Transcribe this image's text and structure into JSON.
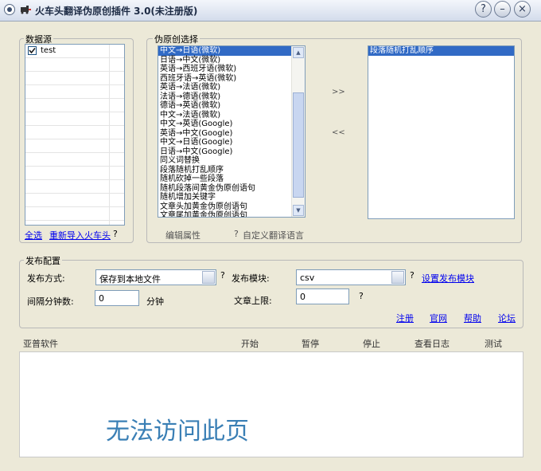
{
  "window": {
    "title": "火车头翻译伪原创插件 3.0(未注册版)",
    "buttons": {
      "help": "?",
      "minimize": "–",
      "close": "×"
    }
  },
  "datasource": {
    "label": "数据源",
    "items": [
      {
        "label": "test",
        "checked": true
      }
    ],
    "select_all": "全选",
    "reimport": "重新导入火车头",
    "help": "?"
  },
  "pseudo": {
    "label": "伪原创选择",
    "options": [
      "中文→日语(微软)",
      "日语→中文(微软)",
      "英语→西班牙语(微软)",
      "西班牙语→英语(微软)",
      "英语→法语(微软)",
      "法语→德语(微软)",
      "德语→英语(微软)",
      "中文→法语(微软)",
      "中文→英语(Google)",
      "英语→中文(Google)",
      "中文→日语(Google)",
      "日语→中文(Google)",
      "同义词替换",
      "段落随机打乱顺序",
      "随机砍掉一些段落",
      "随机段落间黄金伪原创语句",
      "随机增加关键字",
      "文章头加黄金伪原创语句",
      "文章尾加黄金伪原创语句"
    ],
    "selected_index": 0,
    "add_arrow": ">>",
    "remove_arrow": "<<",
    "chosen": [
      "段落随机打乱顺序"
    ],
    "edit_props": "编辑属性",
    "custom_lang_help": "?",
    "custom_lang": "自定义翻译语言"
  },
  "publish": {
    "label": "发布配置",
    "method_label": "发布方式:",
    "method_value": "保存到本地文件",
    "method_help": "?",
    "module_label": "发布模块:",
    "module_value": "csv",
    "module_help": "?",
    "module_settings": "设置发布模块",
    "interval_label": "间隔分钟数:",
    "interval_value": "0",
    "interval_unit": "分钟",
    "limit_label": "文章上限:",
    "limit_value": "0",
    "limit_help": "?",
    "links": {
      "register": "注册",
      "website": "官网",
      "help": "帮助",
      "forum": "论坛"
    }
  },
  "footer": {
    "company": "亚普软件",
    "start": "开始",
    "pause": "暂停",
    "stop": "停止",
    "log": "查看日志",
    "test": "测试"
  },
  "webview": {
    "message": "无法访问此页"
  }
}
